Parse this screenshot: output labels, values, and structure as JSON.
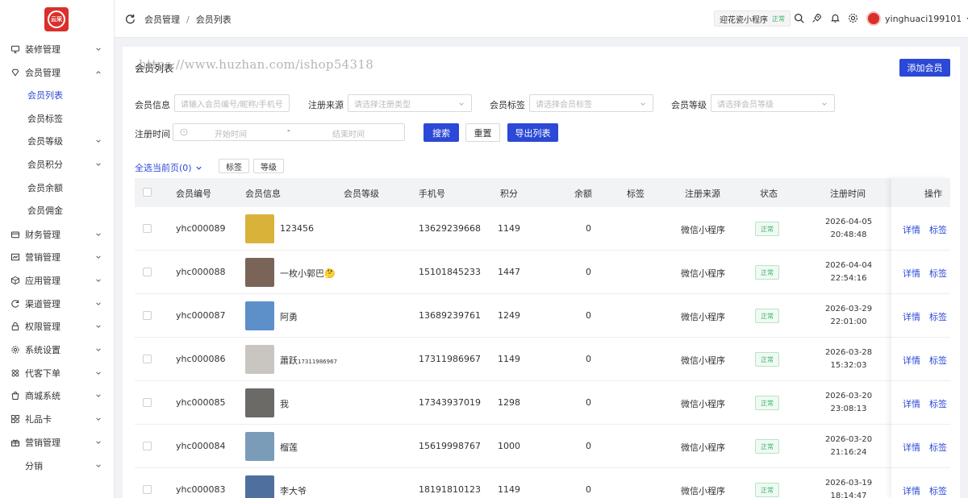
{
  "brand": {
    "logo_text": "云采"
  },
  "sidebar": {
    "items": [
      {
        "label": "装修管理",
        "icon": "monitor-icon"
      },
      {
        "label": "会员管理",
        "icon": "diamond-icon"
      },
      {
        "label": "财务管理",
        "icon": "wallet-icon"
      },
      {
        "label": "营销管理",
        "icon": "chart-icon"
      },
      {
        "label": "应用管理",
        "icon": "box-icon"
      },
      {
        "label": "渠道管理",
        "icon": "refresh-icon"
      },
      {
        "label": "权限管理",
        "icon": "lock-icon"
      },
      {
        "label": "系统设置",
        "icon": "gear-icon"
      },
      {
        "label": "代客下单",
        "icon": "grid-icon"
      },
      {
        "label": "商城系统",
        "icon": "bag-icon"
      },
      {
        "label": "礼品卡",
        "icon": "apps-icon"
      },
      {
        "label": "营销管理",
        "icon": "gift-icon"
      },
      {
        "label": "分销",
        "icon": ""
      }
    ],
    "sub_items": [
      "会员列表",
      "会员标签",
      "会员等级",
      "会员积分",
      "会员余额",
      "会员佣金"
    ]
  },
  "header": {
    "breadcrumb": [
      "会员管理",
      "会员列表"
    ],
    "app_name": "迎花瓷小程序",
    "app_status": "正常",
    "username": "yinghuaci199101"
  },
  "page": {
    "title": "会员列表",
    "watermark": "https://www.huzhan.com/ishop54318",
    "add_button": "添加会员",
    "filters": {
      "member_info_label": "会员信息",
      "member_info_placeholder": "请输入会员编号/昵称/手机号",
      "source_label": "注册来源",
      "source_placeholder": "请选择注册类型",
      "tag_label": "会员标签",
      "tag_placeholder": "请选择会员标签",
      "level_label": "会员等级",
      "level_placeholder": "请选择会员等级",
      "time_label": "注册时间",
      "start_placeholder": "开始时间",
      "end_placeholder": "结束时间",
      "range_sep": "-"
    },
    "buttons": {
      "search": "搜索",
      "reset": "重置",
      "export": "导出列表"
    },
    "select_all": "全选当前页(0)",
    "batch": {
      "tag": "标签",
      "level": "等级"
    }
  },
  "table": {
    "columns": [
      "会员编号",
      "会员信息",
      "会员等级",
      "手机号",
      "积分",
      "余额",
      "标签",
      "注册来源",
      "状态",
      "注册时间",
      "操作"
    ],
    "rows": [
      {
        "id": "yhc000089",
        "name": "123456",
        "level": "",
        "phone": "13629239668",
        "points": "1149",
        "balance": "0",
        "tag": "",
        "source": "微信小程序",
        "status": "正常",
        "date": "2026-04-05",
        "time": "20:48:48",
        "detail": "详情",
        "tag_link": "标签",
        "thumb_color": "#d9b23a"
      },
      {
        "id": "yhc000088",
        "name": "一枚小郭巴🤔",
        "level": "",
        "phone": "15101845233",
        "points": "1447",
        "balance": "0",
        "tag": "",
        "source": "微信小程序",
        "status": "正常",
        "date": "2026-04-04",
        "time": "22:54:16",
        "detail": "详情",
        "tag_link": "标签",
        "thumb_color": "#7a6458"
      },
      {
        "id": "yhc000087",
        "name": "阿勇",
        "level": "",
        "phone": "13689239761",
        "points": "1249",
        "balance": "0",
        "tag": "",
        "source": "微信小程序",
        "status": "正常",
        "date": "2026-03-29",
        "time": "22:01:00",
        "detail": "详情",
        "tag_link": "标签",
        "thumb_color": "#5d8fc9"
      },
      {
        "id": "yhc000086",
        "name": "蕭跃",
        "name_suffix": "17311986967",
        "level": "",
        "phone": "17311986967",
        "points": "1149",
        "balance": "0",
        "tag": "",
        "source": "微信小程序",
        "status": "正常",
        "date": "2026-03-28",
        "time": "15:32:03",
        "detail": "详情",
        "tag_link": "标签",
        "thumb_color": "#c9c6c2"
      },
      {
        "id": "yhc000085",
        "name": "我",
        "level": "",
        "phone": "17343937019",
        "points": "1298",
        "balance": "0",
        "tag": "",
        "source": "微信小程序",
        "status": "正常",
        "date": "2026-03-20",
        "time": "23:08:13",
        "detail": "详情",
        "tag_link": "标签",
        "thumb_color": "#6b6a66"
      },
      {
        "id": "yhc000084",
        "name": "榴莲",
        "level": "",
        "phone": "15619998767",
        "points": "1000",
        "balance": "0",
        "tag": "",
        "source": "微信小程序",
        "status": "正常",
        "date": "2026-03-20",
        "time": "21:16:24",
        "detail": "详情",
        "tag_link": "标签",
        "thumb_color": "#7b9cb8"
      },
      {
        "id": "yhc000083",
        "name": "李大爷",
        "level": "",
        "phone": "18191810123",
        "points": "1149",
        "balance": "0",
        "tag": "",
        "source": "微信小程序",
        "status": "正常",
        "date": "2026-03-19",
        "time": "18:14:47",
        "detail": "详情",
        "tag_link": "标签",
        "thumb_color": "#4f6f9e"
      }
    ]
  },
  "colors": {
    "primary": "#2b49d6",
    "success": "#3cb371",
    "brand_red": "#d9302b"
  }
}
